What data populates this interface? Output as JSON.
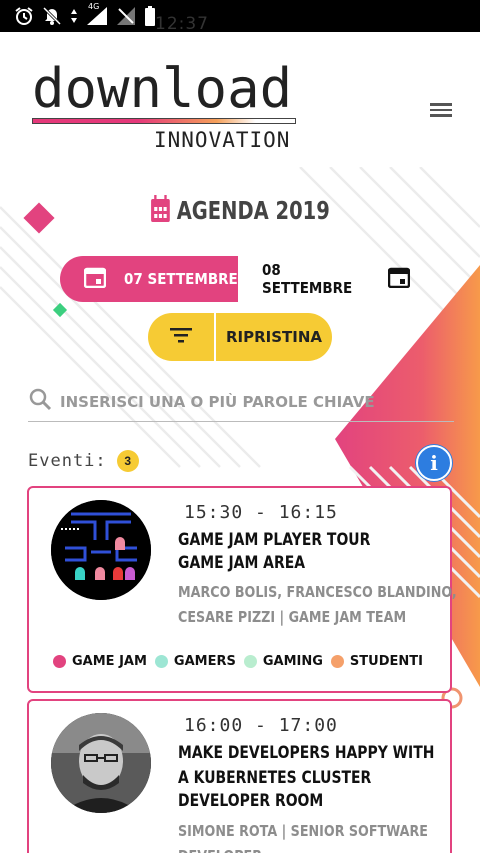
{
  "status_bar": {
    "time": "12:37",
    "network": "4G"
  },
  "header": {
    "logo_word": "download",
    "logo_sub": "INNOVATION"
  },
  "agenda": {
    "title": "AGENDA 2019"
  },
  "dates": {
    "selected": "07 SETTEMBRE",
    "other": "08 SETTEMBRE"
  },
  "filters": {
    "reset_label": "RIPRISTINA"
  },
  "search": {
    "placeholder": "INSERISCI UNA O PIÙ PAROLE CHIAVE"
  },
  "events": {
    "label": "Eventi:",
    "count": "3",
    "items": [
      {
        "time": "15:30 - 16:15",
        "title": "GAME JAM PLAYER TOUR",
        "room": "GAME JAM AREA",
        "speakers": "MARCO BOLIS, FRANCESCO BLANDINO, CESARE PIZZI | GAME JAM TEAM",
        "tags": [
          {
            "label": "GAME JAM",
            "color": "#e2437f"
          },
          {
            "label": "GAMERS",
            "color": "#9de6d4"
          },
          {
            "label": "GAMING",
            "color": "#b9edcf"
          },
          {
            "label": "STUDENTI",
            "color": "#f5a06a"
          }
        ]
      },
      {
        "time": "16:00 - 17:00",
        "title": "MAKE DEVELOPERS HAPPY WITH A KUBERNETES CLUSTER",
        "room": "DEVELOPER ROOM",
        "speakers": "SIMONE ROTA | SENIOR SOFTWARE DEVELOPER"
      }
    ]
  },
  "colors": {
    "accent_pink": "#e2437f",
    "accent_yellow": "#f6cb34",
    "info_blue": "#2d7de0"
  }
}
